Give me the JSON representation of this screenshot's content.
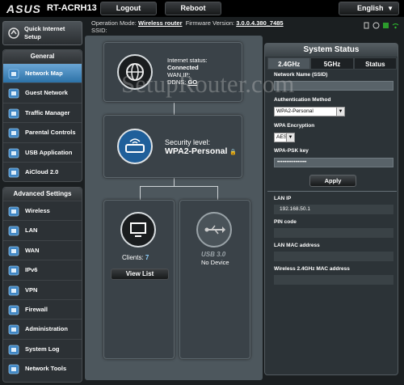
{
  "header": {
    "logo": "ASUS",
    "model": "RT-ACRH13",
    "logout_label": "Logout",
    "reboot_label": "Reboot",
    "language": "English"
  },
  "info": {
    "operation_mode_label": "Operation Mode:",
    "operation_mode_value": "Wireless router",
    "firmware_label": "Firmware Version:",
    "firmware_value": "3.0.0.4.380_7485",
    "ssid_label": "SSID:"
  },
  "sidebar": {
    "quick_setup": "Quick Internet Setup",
    "general_title": "General",
    "general_items": [
      {
        "label": "Network Map",
        "icon": "network-map-icon"
      },
      {
        "label": "Guest Network",
        "icon": "guest-network-icon"
      },
      {
        "label": "Traffic Manager",
        "icon": "traffic-manager-icon"
      },
      {
        "label": "Parental Controls",
        "icon": "parental-controls-icon"
      },
      {
        "label": "USB Application",
        "icon": "usb-application-icon"
      },
      {
        "label": "AiCloud 2.0",
        "icon": "aicloud-icon"
      }
    ],
    "advanced_title": "Advanced Settings",
    "advanced_items": [
      {
        "label": "Wireless",
        "icon": "wireless-icon"
      },
      {
        "label": "LAN",
        "icon": "lan-icon"
      },
      {
        "label": "WAN",
        "icon": "wan-icon"
      },
      {
        "label": "IPv6",
        "icon": "ipv6-icon"
      },
      {
        "label": "VPN",
        "icon": "vpn-icon"
      },
      {
        "label": "Firewall",
        "icon": "firewall-icon"
      },
      {
        "label": "Administration",
        "icon": "administration-icon"
      },
      {
        "label": "System Log",
        "icon": "system-log-icon"
      },
      {
        "label": "Network Tools",
        "icon": "network-tools-icon"
      }
    ]
  },
  "map": {
    "internet_status_label": "Internet status:",
    "internet_status_value": "Connected",
    "wan_ip_label": "WAN IP:",
    "ddns_label": "DDNS:",
    "ddns_value": "GO",
    "security_label": "Security level:",
    "security_value": "WPA2-Personal",
    "clients_label": "Clients:",
    "clients_count": "7",
    "view_list": "View List",
    "usb_label": "USB 3.0",
    "usb_status": "No Device"
  },
  "status": {
    "title": "System Status",
    "tabs": [
      "2.4GHz",
      "5GHz",
      "Status"
    ],
    "ssid_label": "Network Name (SSID)",
    "ssid_value": "",
    "auth_label": "Authentication Method",
    "auth_value": "WPA2-Personal",
    "enc_label": "WPA Encryption",
    "enc_value": "AES",
    "psk_label": "WPA-PSK key",
    "psk_value": "••••••••••••••••",
    "apply_label": "Apply",
    "lan_ip_label": "LAN IP",
    "lan_ip_value": "192.168.50.1",
    "pin_label": "PIN code",
    "pin_value": "",
    "lan_mac_label": "LAN MAC address",
    "lan_mac_value": "",
    "wl_mac_label": "Wireless 2.4GHz MAC address",
    "wl_mac_value": ""
  },
  "watermark": "SetupRouter.com"
}
